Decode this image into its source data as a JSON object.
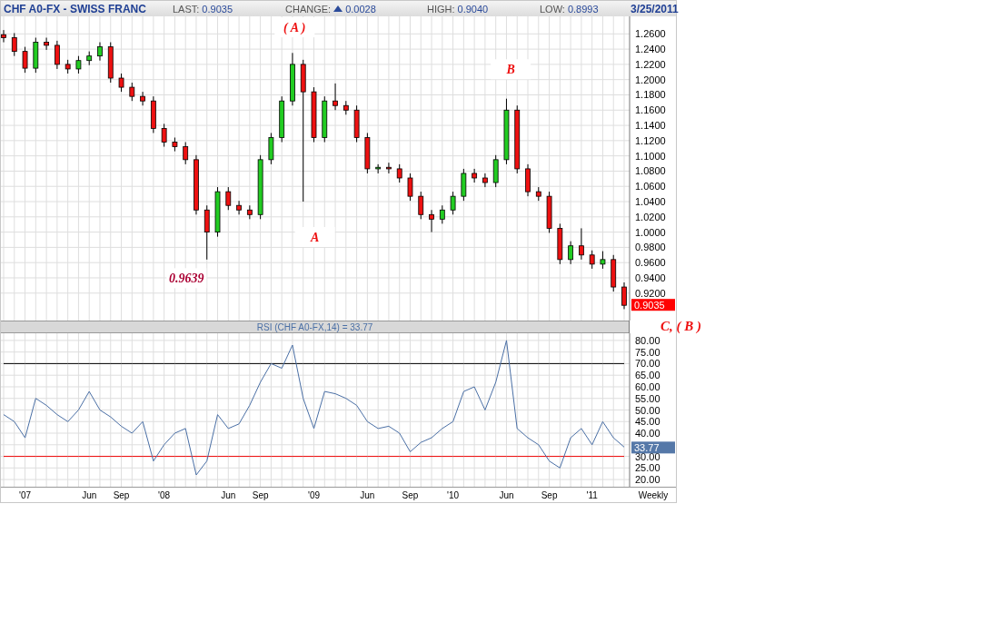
{
  "header": {
    "symbol": "CHF A0-FX - SWISS FRANC",
    "last_label": "LAST:",
    "last": "0.9035",
    "change_label": "CHANGE:",
    "change": "0.0028",
    "high_label": "HIGH:",
    "high": "0.9040",
    "low_label": "LOW:",
    "low": "0.8993",
    "date": "3/25/2011"
  },
  "price_panel": {
    "last_tag": "0.9035",
    "chart_data": {
      "type": "candlestick",
      "ohlc": [
        [
          1.259,
          1.265,
          1.249,
          1.255
        ],
        [
          1.255,
          1.261,
          1.231,
          1.237
        ],
        [
          1.237,
          1.243,
          1.209,
          1.215
        ],
        [
          1.215,
          1.255,
          1.209,
          1.249
        ],
        [
          1.249,
          1.255,
          1.239,
          1.245
        ],
        [
          1.245,
          1.251,
          1.214,
          1.22
        ],
        [
          1.22,
          1.226,
          1.208,
          1.214
        ],
        [
          1.214,
          1.231,
          1.208,
          1.225
        ],
        [
          1.225,
          1.237,
          1.219,
          1.231
        ],
        [
          1.231,
          1.249,
          1.225,
          1.243
        ],
        [
          1.243,
          1.249,
          1.196,
          1.202
        ],
        [
          1.202,
          1.208,
          1.184,
          1.19
        ],
        [
          1.19,
          1.196,
          1.172,
          1.178
        ],
        [
          1.178,
          1.184,
          1.166,
          1.172
        ],
        [
          1.172,
          1.178,
          1.13,
          1.136
        ],
        [
          1.136,
          1.142,
          1.112,
          1.118
        ],
        [
          1.118,
          1.124,
          1.106,
          1.112
        ],
        [
          1.112,
          1.118,
          1.089,
          1.095
        ],
        [
          1.095,
          1.101,
          1.023,
          1.029
        ],
        [
          1.029,
          1.035,
          0.964,
          1.0
        ],
        [
          1.0,
          1.059,
          0.994,
          1.053
        ],
        [
          1.053,
          1.059,
          1.029,
          1.035
        ],
        [
          1.035,
          1.041,
          1.023,
          1.029
        ],
        [
          1.029,
          1.035,
          1.017,
          1.023
        ],
        [
          1.023,
          1.101,
          1.017,
          1.095
        ],
        [
          1.095,
          1.13,
          1.089,
          1.124
        ],
        [
          1.124,
          1.178,
          1.118,
          1.172
        ],
        [
          1.172,
          1.235,
          1.166,
          1.22
        ],
        [
          1.22,
          1.226,
          1.04,
          1.184
        ],
        [
          1.184,
          1.19,
          1.118,
          1.124
        ],
        [
          1.124,
          1.178,
          1.118,
          1.172
        ],
        [
          1.172,
          1.195,
          1.16,
          1.166
        ],
        [
          1.166,
          1.172,
          1.154,
          1.16
        ],
        [
          1.16,
          1.166,
          1.118,
          1.124
        ],
        [
          1.124,
          1.13,
          1.077,
          1.083
        ],
        [
          1.083,
          1.089,
          1.077,
          1.085
        ],
        [
          1.085,
          1.091,
          1.077,
          1.083
        ],
        [
          1.083,
          1.089,
          1.065,
          1.071
        ],
        [
          1.071,
          1.077,
          1.041,
          1.047
        ],
        [
          1.047,
          1.053,
          1.017,
          1.023
        ],
        [
          1.023,
          1.029,
          1.0,
          1.017
        ],
        [
          1.017,
          1.035,
          1.011,
          1.029
        ],
        [
          1.029,
          1.053,
          1.023,
          1.047
        ],
        [
          1.047,
          1.083,
          1.041,
          1.077
        ],
        [
          1.077,
          1.083,
          1.065,
          1.071
        ],
        [
          1.071,
          1.077,
          1.059,
          1.065
        ],
        [
          1.065,
          1.101,
          1.059,
          1.095
        ],
        [
          1.095,
          1.175,
          1.089,
          1.16
        ],
        [
          1.16,
          1.166,
          1.077,
          1.083
        ],
        [
          1.083,
          1.089,
          1.047,
          1.053
        ],
        [
          1.053,
          1.059,
          1.041,
          1.047
        ],
        [
          1.047,
          1.053,
          0.999,
          1.005
        ],
        [
          1.005,
          1.011,
          0.958,
          0.964
        ],
        [
          0.964,
          0.988,
          0.958,
          0.982
        ],
        [
          0.982,
          1.005,
          0.964,
          0.97
        ],
        [
          0.97,
          0.976,
          0.952,
          0.958
        ],
        [
          0.958,
          0.975,
          0.952,
          0.964
        ],
        [
          0.964,
          0.97,
          0.922,
          0.928
        ],
        [
          0.928,
          0.934,
          0.899,
          0.904
        ]
      ],
      "ylim": [
        0.884,
        1.283
      ],
      "yticks": [
        {
          "value": 1.26,
          "label": "1.2600"
        },
        {
          "value": 1.24,
          "label": "1.2400"
        },
        {
          "value": 1.22,
          "label": "1.2200"
        },
        {
          "value": 1.2,
          "label": "1.2000"
        },
        {
          "value": 1.18,
          "label": "1.1800"
        },
        {
          "value": 1.16,
          "label": "1.1600"
        },
        {
          "value": 1.14,
          "label": "1.1400"
        },
        {
          "value": 1.12,
          "label": "1.1200"
        },
        {
          "value": 1.1,
          "label": "1.1000"
        },
        {
          "value": 1.08,
          "label": "1.0800"
        },
        {
          "value": 1.06,
          "label": "1.0600"
        },
        {
          "value": 1.04,
          "label": "1.0400"
        },
        {
          "value": 1.02,
          "label": "1.0200"
        },
        {
          "value": 1.0,
          "label": "1.0000"
        },
        {
          "value": 0.98,
          "label": "0.9800"
        },
        {
          "value": 0.96,
          "label": "0.9600"
        },
        {
          "value": 0.94,
          "label": "0.9400"
        },
        {
          "value": 0.92,
          "label": "0.9200"
        }
      ],
      "grid": true,
      "annotations": [
        "( A )",
        "B",
        "A",
        "0.9639"
      ]
    }
  },
  "outside_note": "C, ( B )",
  "rsi_panel": {
    "title": "RSI (CHF A0-FX,14) = 33.77",
    "last_tag": "33.77",
    "period_label": "Weekly",
    "chart_data": {
      "type": "line",
      "categories": [
        null,
        null,
        "'07",
        null,
        null,
        null,
        null,
        null,
        "Jun",
        null,
        null,
        "Sep",
        null,
        null,
        null,
        "'08",
        null,
        null,
        null,
        null,
        null,
        "Jun",
        null,
        null,
        "Sep",
        null,
        null,
        null,
        null,
        "'09",
        null,
        null,
        null,
        null,
        "Jun",
        null,
        null,
        null,
        "Sep",
        null,
        null,
        null,
        "'10",
        null,
        null,
        null,
        null,
        "Jun",
        null,
        null,
        null,
        "Sep",
        null,
        null,
        null,
        "'11",
        null,
        null,
        null
      ],
      "series": [
        {
          "color": "#4a6fa5",
          "values": [
            48,
            45,
            38,
            55,
            52,
            48,
            45,
            50,
            58,
            50,
            47,
            43,
            40,
            45,
            28,
            35,
            40,
            42,
            22,
            28,
            48,
            42,
            44,
            52,
            62,
            70,
            68,
            78,
            55,
            42,
            58,
            57,
            55,
            52,
            45,
            42,
            43,
            40,
            32,
            36,
            38,
            42,
            45,
            58,
            60,
            50,
            62,
            80,
            42,
            38,
            35,
            28,
            25,
            38,
            42,
            35,
            45,
            38,
            34
          ]
        },
        {
          "color": "#000000",
          "values": [
            70,
            70,
            70,
            70,
            70,
            70,
            70,
            70,
            70,
            70,
            70,
            70,
            70,
            70,
            70,
            70,
            70,
            70,
            70,
            70,
            70,
            70,
            70,
            70,
            70,
            70,
            70,
            70,
            70,
            70,
            70,
            70,
            70,
            70,
            70,
            70,
            70,
            70,
            70,
            70,
            70,
            70,
            70,
            70,
            70,
            70,
            70,
            70,
            70,
            70,
            70,
            70,
            70,
            70,
            70,
            70,
            70,
            70,
            70
          ]
        },
        {
          "color": "#ee0000",
          "values": [
            30,
            30,
            30,
            30,
            30,
            30,
            30,
            30,
            30,
            30,
            30,
            30,
            30,
            30,
            30,
            30,
            30,
            30,
            30,
            30,
            30,
            30,
            30,
            30,
            30,
            30,
            30,
            30,
            30,
            30,
            30,
            30,
            30,
            30,
            30,
            30,
            30,
            30,
            30,
            30,
            30,
            30,
            30,
            30,
            30,
            30,
            30,
            30,
            30,
            30,
            30,
            30,
            30,
            30,
            30,
            30,
            30,
            30,
            30
          ]
        }
      ],
      "ylim": [
        16.9,
        83.1
      ],
      "yticks": [
        {
          "value": 80,
          "label": "80.00"
        },
        {
          "value": 75,
          "label": "75.00"
        },
        {
          "value": 70,
          "label": "70.00"
        },
        {
          "value": 65,
          "label": "65.00"
        },
        {
          "value": 60,
          "label": "60.00"
        },
        {
          "value": 55,
          "label": "55.00"
        },
        {
          "value": 50,
          "label": "50.00"
        },
        {
          "value": 45,
          "label": "45.00"
        },
        {
          "value": 40,
          "label": "40.00"
        },
        {
          "value": 30,
          "label": "30.00"
        },
        {
          "value": 25,
          "label": "25.00"
        },
        {
          "value": 20,
          "label": "20.00"
        }
      ],
      "grid": true
    }
  }
}
